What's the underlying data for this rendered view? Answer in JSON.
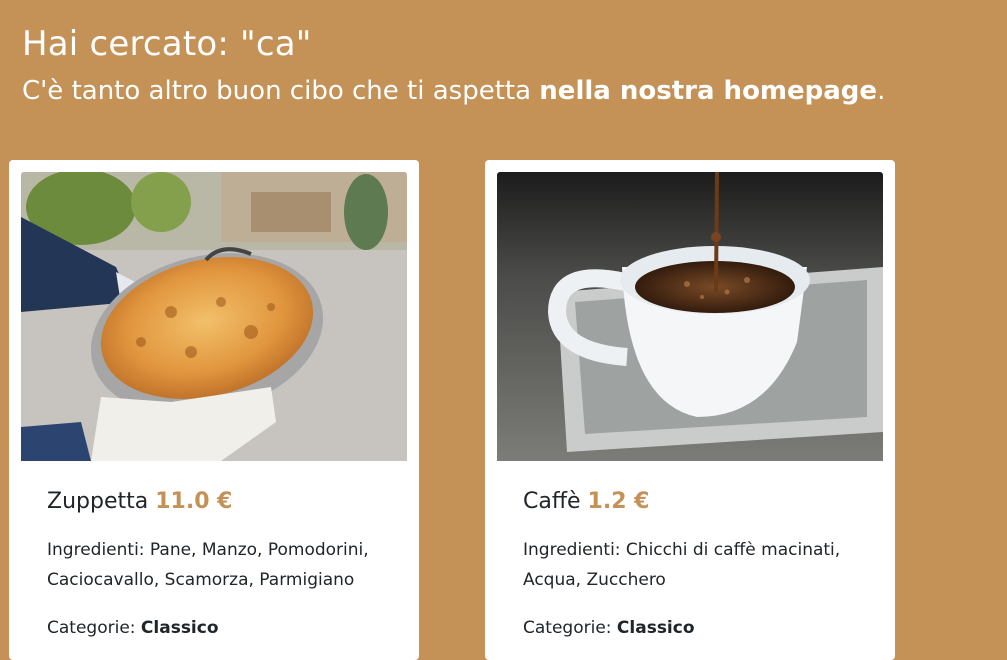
{
  "search": {
    "heading_prefix": "Hai cercato: ",
    "query": "\"ca\"",
    "subheading_text": "C'è tanto altro buon cibo che ti aspetta ",
    "homepage_link": "nella nostra homepage",
    "subheading_end": "."
  },
  "results": [
    {
      "name": "Zuppetta",
      "price": "11.0 €",
      "ingredients_label": "Ingredienti: ",
      "ingredients": "Pane, Manzo, Pomodorini, Caciocavallo, Scamorza, Parmigiano",
      "categories_label": "Categorie: ",
      "category": "Classico",
      "image": "baked-pasta-pan-photo"
    },
    {
      "name": "Caffè",
      "price": "1.2 €",
      "ingredients_label": "Ingredienti: ",
      "ingredients": "Chicchi di caffè macinati, Acqua, Zucchero",
      "categories_label": "Categorie: ",
      "category": "Classico",
      "image": "coffee-cup-pour-photo"
    }
  ],
  "colors": {
    "background": "#c49257",
    "accent_price": "#c49257",
    "card": "#ffffff"
  }
}
